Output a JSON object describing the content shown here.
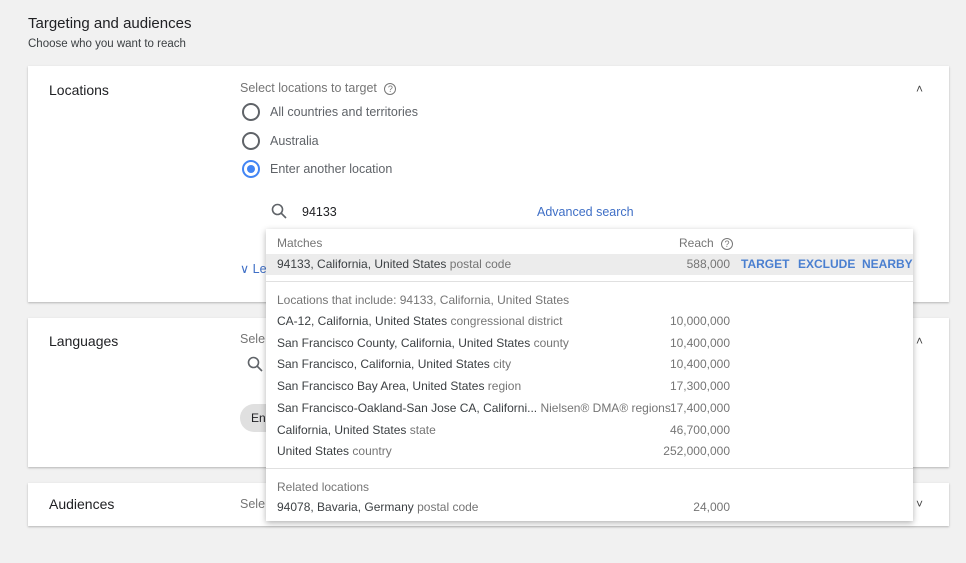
{
  "header": {
    "title": "Targeting and audiences",
    "subtitle": "Choose who you want to reach"
  },
  "locations": {
    "label": "Locations",
    "prompt": "Select locations to target",
    "options": [
      {
        "label": "All countries and territories",
        "selected": false
      },
      {
        "label": "Australia",
        "selected": false
      },
      {
        "label": "Enter another location",
        "selected": true
      }
    ],
    "search_value": "94133",
    "advanced_search": "Advanced search",
    "collapsed_link_fragment": "Le"
  },
  "languages": {
    "label": "Languages",
    "prompt_fragment": "Sele",
    "chip_fragment": "En"
  },
  "audiences": {
    "label": "Audiences",
    "prompt_fragment": "Sele"
  },
  "popup": {
    "matches_header": "Matches",
    "reach_header": "Reach",
    "match": {
      "name": "94133, California, United States",
      "type": "postal code",
      "reach": "588,000",
      "target": "TARGET",
      "exclude": "EXCLUDE",
      "nearby": "NEARBY"
    },
    "includes_header": "Locations that include: 94133, California, United States",
    "includes": [
      {
        "name": "CA-12, California, United States",
        "type": "congressional district",
        "reach": "10,000,000"
      },
      {
        "name": "San Francisco County, California, United States",
        "type": "county",
        "reach": "10,400,000"
      },
      {
        "name": "San Francisco, California, United States",
        "type": "city",
        "reach": "10,400,000"
      },
      {
        "name": "San Francisco Bay Area, United States",
        "type": "region",
        "reach": "17,300,000"
      },
      {
        "name": "San Francisco-Oakland-San Jose CA, Californi...",
        "type": "Nielsen® DMA® regions",
        "reach": "17,400,000"
      },
      {
        "name": "California, United States",
        "type": "state",
        "reach": "46,700,000"
      },
      {
        "name": "United States",
        "type": "country",
        "reach": "252,000,000"
      }
    ],
    "related_header": "Related locations",
    "related": [
      {
        "name": "94078, Bavaria, Germany",
        "type": "postal code",
        "reach": "24,000"
      }
    ]
  },
  "colors": {
    "accent": "#4285f4",
    "link": "#3f6fc6",
    "background": "#f1f1f1"
  }
}
